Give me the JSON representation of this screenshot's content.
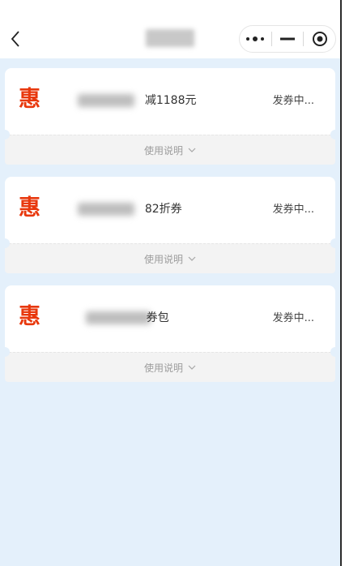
{
  "header": {
    "back_icon": "chevron-left-icon",
    "title": "",
    "capsule": {
      "more_icon": "more-dots-icon",
      "minimize_icon": "minimize-icon",
      "close_icon": "target-circle-icon"
    }
  },
  "colors": {
    "page_background": "#e4f0fb",
    "hui_red": "#e8380d",
    "footer_background": "#f3f3f3"
  },
  "coupons": [
    {
      "badge": "惠",
      "name_visible": "减1188元",
      "status": "发券中...",
      "usage_label": "使用说明"
    },
    {
      "badge": "惠",
      "name_visible": "82折券",
      "status": "发券中...",
      "usage_label": "使用说明"
    },
    {
      "badge": "惠",
      "name_visible": "券包",
      "status": "发券中...",
      "usage_label": "使用说明"
    }
  ]
}
